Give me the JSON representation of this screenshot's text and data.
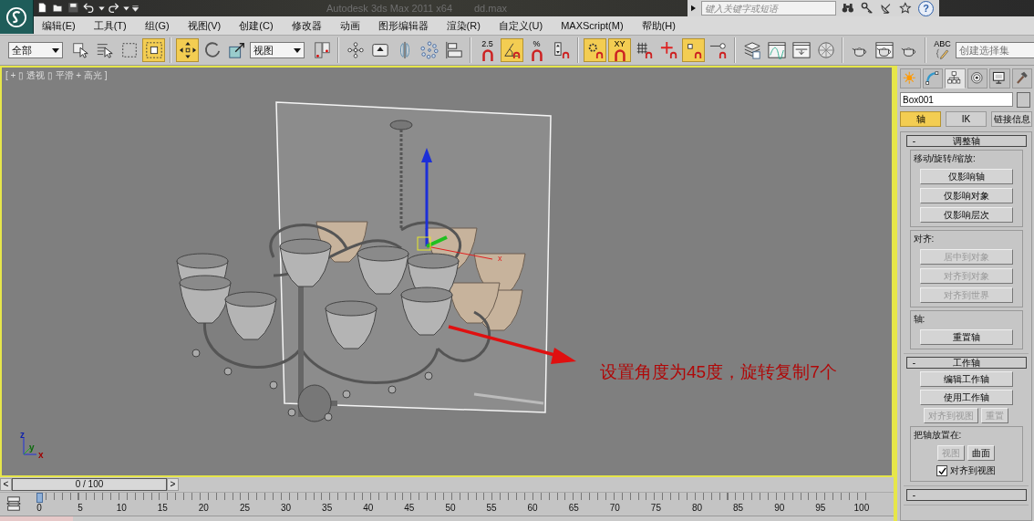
{
  "title_bar": {
    "app_title": "Autodesk 3ds Max  2011 x64",
    "file_name": "dd.max",
    "search": {
      "placeholder": "键入关键字或短语"
    },
    "help_label": "?"
  },
  "menu": [
    "编辑(E)",
    "工具(T)",
    "组(G)",
    "视图(V)",
    "创建(C)",
    "修改器",
    "动画",
    "图形编辑器",
    "渲染(R)",
    "自定义(U)",
    "MAXScript(M)",
    "帮助(H)"
  ],
  "toolbar": {
    "groups": [
      {
        "items": [
          {
            "kind": "dropdown",
            "value": "全部"
          },
          {
            "kind": "tool",
            "on": false
          },
          {
            "kind": "tool",
            "on": false
          },
          {
            "kind": "tool",
            "on": false
          },
          {
            "kind": "tool",
            "on": true
          }
        ]
      },
      {
        "items": [
          {
            "kind": "tool",
            "on": true
          },
          {
            "kind": "tool",
            "on": false
          },
          {
            "kind": "tool",
            "on": false
          },
          {
            "kind": "dropdown",
            "value": "视图"
          },
          {
            "kind": "tool",
            "on": false
          }
        ]
      },
      {
        "items": [
          {
            "kind": "tool",
            "on": false
          },
          {
            "kind": "tool",
            "on": false
          },
          {
            "kind": "tool",
            "on": false
          },
          {
            "kind": "tool",
            "on": false
          },
          {
            "kind": "tool",
            "on": false
          }
        ]
      },
      {
        "items": [
          {
            "kind": "tool",
            "on": false,
            "label": "2.5"
          },
          {
            "kind": "tool",
            "on": true
          },
          {
            "kind": "tool",
            "on": false,
            "label": "%"
          },
          {
            "kind": "tool",
            "on": false
          }
        ]
      },
      {
        "items": [
          {
            "kind": "tool",
            "on": true
          },
          {
            "kind": "tool",
            "on": true,
            "label": "XY"
          },
          {
            "kind": "tool",
            "on": false
          },
          {
            "kind": "tool",
            "on": false
          },
          {
            "kind": "tool",
            "on": true
          },
          {
            "kind": "tool",
            "on": false
          }
        ]
      },
      {
        "items": [
          {
            "kind": "tool",
            "on": false
          },
          {
            "kind": "tool",
            "on": false
          },
          {
            "kind": "tool",
            "on": false
          },
          {
            "kind": "tool",
            "on": false
          }
        ]
      },
      {
        "items": [
          {
            "kind": "tool",
            "on": false
          },
          {
            "kind": "tool",
            "on": false
          },
          {
            "kind": "tool",
            "on": false
          }
        ]
      },
      {
        "items": [
          {
            "kind": "tool",
            "on": false,
            "label": "ABC"
          },
          {
            "kind": "dropdown",
            "placeholder": "创建选择集"
          }
        ]
      }
    ]
  },
  "viewport": {
    "label": "[ + ▯ 透视 ▯ 平滑 + 高光 ]",
    "gizmo_label": "x",
    "corner_axes": [
      "z",
      "y",
      "x"
    ],
    "annotation": "设置角度为45度，旋转复制7个"
  },
  "frame_slider": {
    "prev": "<",
    "value": "0 / 100",
    "next": ">"
  },
  "timeline": {
    "ticks": [
      "0",
      "5",
      "10",
      "15",
      "20",
      "25",
      "30",
      "35",
      "40",
      "45",
      "50",
      "55",
      "60",
      "65",
      "70",
      "75",
      "80",
      "85",
      "90",
      "95",
      "100"
    ]
  },
  "command_panel": {
    "tabs": [
      {
        "selected": false
      },
      {
        "selected": false
      },
      {
        "selected": true
      },
      {
        "selected": false
      },
      {
        "selected": false
      },
      {
        "selected": false
      }
    ],
    "object_name": "Box001",
    "subtabs": [
      {
        "label": "轴",
        "selected": true
      },
      {
        "label": "IK",
        "selected": false
      },
      {
        "label": "链接信息",
        "selected": false
      }
    ],
    "rollouts": [
      {
        "sign": "-",
        "title": "调整轴",
        "items": [
          {
            "kind": "group",
            "title": "移动/旋转/缩放:",
            "items": [
              {
                "kind": "button",
                "label": "仅影响轴",
                "disabled": false
              },
              {
                "kind": "button",
                "label": "仅影响对象",
                "disabled": false
              },
              {
                "kind": "button",
                "label": "仅影响层次",
                "disabled": false
              }
            ]
          },
          {
            "kind": "group",
            "title": "对齐:",
            "items": [
              {
                "kind": "button",
                "label": "居中到对象",
                "disabled": true
              },
              {
                "kind": "button",
                "label": "对齐到对象",
                "disabled": true
              },
              {
                "kind": "button",
                "label": "对齐到世界",
                "disabled": true
              }
            ]
          },
          {
            "kind": "group",
            "title": "轴:",
            "items": [
              {
                "kind": "button",
                "label": "重置轴",
                "disabled": false
              }
            ]
          }
        ]
      },
      {
        "sign": "-",
        "title": "工作轴",
        "items": [
          {
            "kind": "button",
            "label": "编辑工作轴",
            "disabled": false
          },
          {
            "kind": "button",
            "label": "使用工作轴",
            "disabled": false
          },
          {
            "kind": "button_row",
            "buttons": [
              {
                "label": "对齐到视图",
                "disabled": true
              },
              {
                "label": "重置",
                "disabled": true
              }
            ]
          },
          {
            "kind": "group",
            "title": "把轴放置在:",
            "items": [
              {
                "kind": "button_row",
                "buttons": [
                  {
                    "label": "视图",
                    "disabled": true
                  },
                  {
                    "label": "曲面",
                    "disabled": false
                  }
                ]
              },
              {
                "kind": "checkbox",
                "label": "对齐到视图",
                "checked": true
              }
            ]
          }
        ]
      },
      {
        "sign": "-"
      }
    ]
  }
}
